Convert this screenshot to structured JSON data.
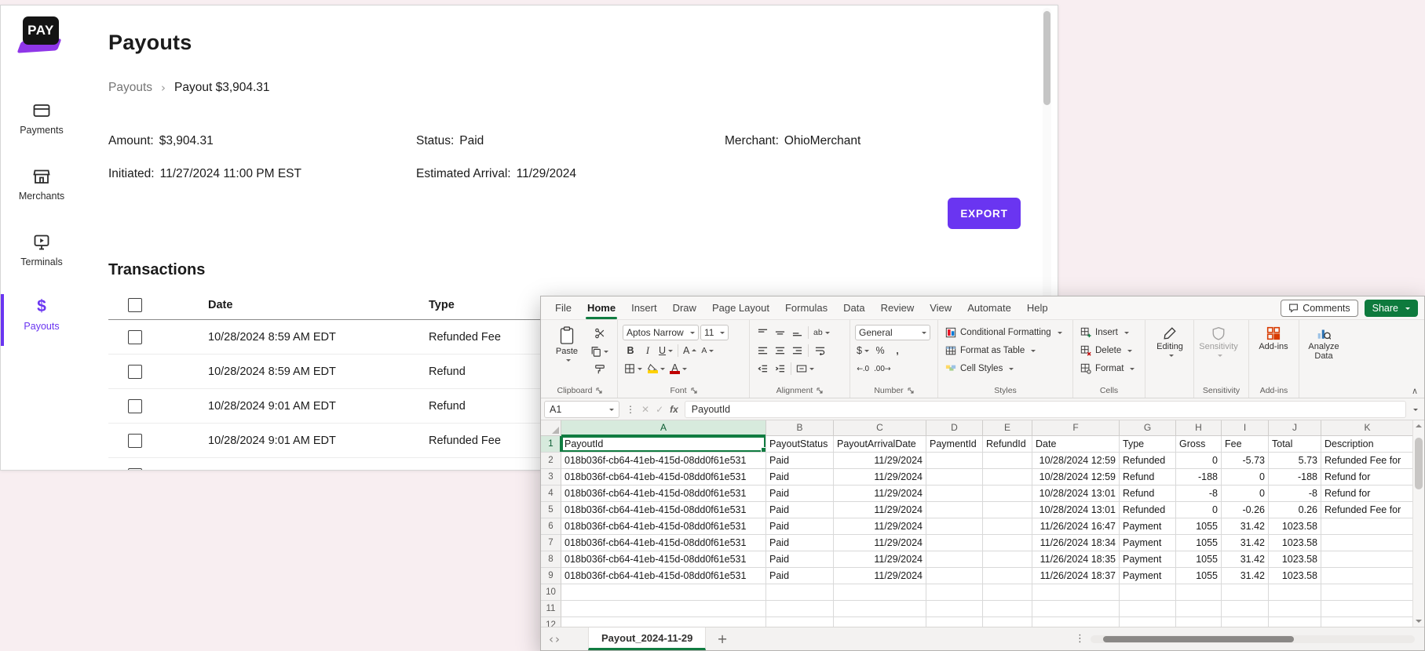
{
  "colors": {
    "brand_purple": "#6A35F1",
    "logo_purple": "#8F36E8",
    "excel_green": "#107C41",
    "share_green": "#0E7A3D",
    "canvas_bg": "#f8eef1"
  },
  "glyphs": {
    "sep": "›",
    "ellipsis": "⋮",
    "x": "✕",
    "check": "✓",
    "fx": "fx",
    "prev": "‹",
    "next": "›",
    "plus": "+",
    "dollar": "$",
    "percent": "%",
    "comma": ",",
    "incdec": "←.0",
    "decdec": ".00→",
    "ab": "ab",
    "A": "A",
    "B": "B",
    "I": "I",
    "U": "U",
    "collapse": "∧"
  },
  "app": {
    "logo_text": "PAY",
    "nav": [
      {
        "label": "Payments"
      },
      {
        "label": "Merchants"
      },
      {
        "label": "Terminals"
      },
      {
        "label": "Payouts"
      }
    ],
    "page_title": "Payouts",
    "breadcrumb": {
      "parent": "Payouts",
      "current": "Payout $3,904.31"
    },
    "details": [
      {
        "label": "Amount:",
        "value": "$3,904.31"
      },
      {
        "label": "Status:",
        "value": "Paid"
      },
      {
        "label": "Merchant:",
        "value": "OhioMerchant"
      },
      {
        "label": "Initiated:",
        "value": "11/27/2024 11:00 PM EST"
      },
      {
        "label": "Estimated Arrival:",
        "value": "11/29/2024"
      }
    ],
    "export_label": "EXPORT",
    "transactions": {
      "title": "Transactions",
      "col_date": "Date",
      "col_type": "Type",
      "rows": [
        {
          "date": "10/28/2024 8:59 AM EDT",
          "type": "Refunded Fee"
        },
        {
          "date": "10/28/2024 8:59 AM EDT",
          "type": "Refund"
        },
        {
          "date": "10/28/2024 9:01 AM EDT",
          "type": "Refund"
        },
        {
          "date": "10/28/2024 9:01 AM EDT",
          "type": "Refunded Fee"
        }
      ]
    }
  },
  "excel": {
    "ribbon_tabs": [
      "File",
      "Home",
      "Insert",
      "Draw",
      "Page Layout",
      "Formulas",
      "Data",
      "Review",
      "View",
      "Automate",
      "Help"
    ],
    "comments_label": "Comments",
    "share_label": "Share",
    "clipboard": {
      "paste": "Paste",
      "group": "Clipboard"
    },
    "font_group": {
      "name": "Aptos Narrow",
      "size": "11",
      "group": "Font"
    },
    "alignment_group": {
      "group": "Alignment"
    },
    "number_group": {
      "format": "General",
      "group": "Number"
    },
    "styles_group": {
      "conditional": "Conditional Formatting",
      "table": "Format as Table",
      "cell": "Cell Styles",
      "group": "Styles"
    },
    "cells_group": {
      "insert": "Insert",
      "delete": "Delete",
      "format": "Format",
      "group": "Cells"
    },
    "editing_label": "Editing",
    "sensitivity_label": "Sensitivity",
    "addins_label": "Add-ins",
    "analyze_label": "Analyze Data",
    "name_box": "A1",
    "formula_value": "PayoutId",
    "sheet_tab": "Payout_2024-11-29",
    "sheet": {
      "column_letters": [
        "A",
        "B",
        "C",
        "D",
        "E",
        "F",
        "G",
        "H",
        "I",
        "J",
        "K"
      ],
      "row_numbers": [
        "1",
        "2",
        "3",
        "4",
        "5",
        "6",
        "7",
        "8",
        "9",
        "10",
        "11",
        "12"
      ],
      "header_row": [
        "PayoutId",
        "PayoutStatus",
        "PayoutArrivalDate",
        "PaymentId",
        "RefundId",
        "Date",
        "Type",
        "Gross",
        "Fee",
        "Total",
        "Description"
      ],
      "data_rows": [
        [
          "018b036f-cb64-41eb-415d-08dd0f61e531",
          "Paid",
          "11/29/2024",
          "",
          "",
          "10/28/2024 12:59",
          "Refunded",
          "0",
          "-5.73",
          "5.73",
          "Refunded Fee for"
        ],
        [
          "018b036f-cb64-41eb-415d-08dd0f61e531",
          "Paid",
          "11/29/2024",
          "",
          "",
          "10/28/2024 12:59",
          "Refund",
          "-188",
          "0",
          "-188",
          "Refund for"
        ],
        [
          "018b036f-cb64-41eb-415d-08dd0f61e531",
          "Paid",
          "11/29/2024",
          "",
          "",
          "10/28/2024 13:01",
          "Refund",
          "-8",
          "0",
          "-8",
          "Refund for"
        ],
        [
          "018b036f-cb64-41eb-415d-08dd0f61e531",
          "Paid",
          "11/29/2024",
          "",
          "",
          "10/28/2024 13:01",
          "Refunded",
          "0",
          "-0.26",
          "0.26",
          "Refunded Fee for"
        ],
        [
          "018b036f-cb64-41eb-415d-08dd0f61e531",
          "Paid",
          "11/29/2024",
          "",
          "",
          "11/26/2024 16:47",
          "Payment",
          "1055",
          "31.42",
          "1023.58",
          ""
        ],
        [
          "018b036f-cb64-41eb-415d-08dd0f61e531",
          "Paid",
          "11/29/2024",
          "",
          "",
          "11/26/2024 18:34",
          "Payment",
          "1055",
          "31.42",
          "1023.58",
          ""
        ],
        [
          "018b036f-cb64-41eb-415d-08dd0f61e531",
          "Paid",
          "11/29/2024",
          "",
          "",
          "11/26/2024 18:35",
          "Payment",
          "1055",
          "31.42",
          "1023.58",
          ""
        ],
        [
          "018b036f-cb64-41eb-415d-08dd0f61e531",
          "Paid",
          "11/29/2024",
          "",
          "",
          "11/26/2024 18:37",
          "Payment",
          "1055",
          "31.42",
          "1023.58",
          ""
        ]
      ]
    }
  }
}
